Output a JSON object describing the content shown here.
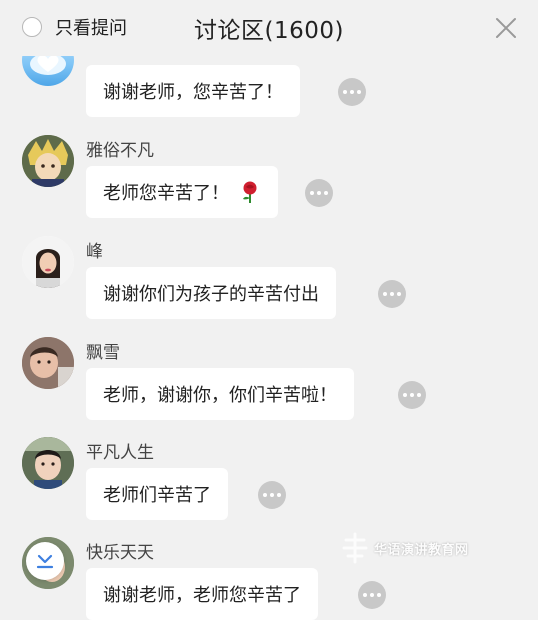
{
  "header": {
    "only_questions_label": "只看提问",
    "title": "讨论区(1600)"
  },
  "comments": [
    {
      "user": "",
      "text": "谢谢老师，您辛苦了！"
    },
    {
      "user": "雅俗不凡",
      "text": "老师您辛苦了！"
    },
    {
      "user": "峰",
      "text": "谢谢你们为孩子的辛苦付出"
    },
    {
      "user": "飘雪",
      "text": "老师，谢谢你，你们辛苦啦！"
    },
    {
      "user": "平凡人生",
      "text": "老师们辛苦了"
    },
    {
      "user": "快乐天天",
      "text": "谢谢老师，老师您辛苦了"
    }
  ],
  "watermark": {
    "text": "华语演讲教育网"
  },
  "icons": {
    "more": "ellipsis-icon",
    "close": "close-icon",
    "scroll": "scroll-to-bottom-icon",
    "emoji": "rose-emoji-icon"
  }
}
